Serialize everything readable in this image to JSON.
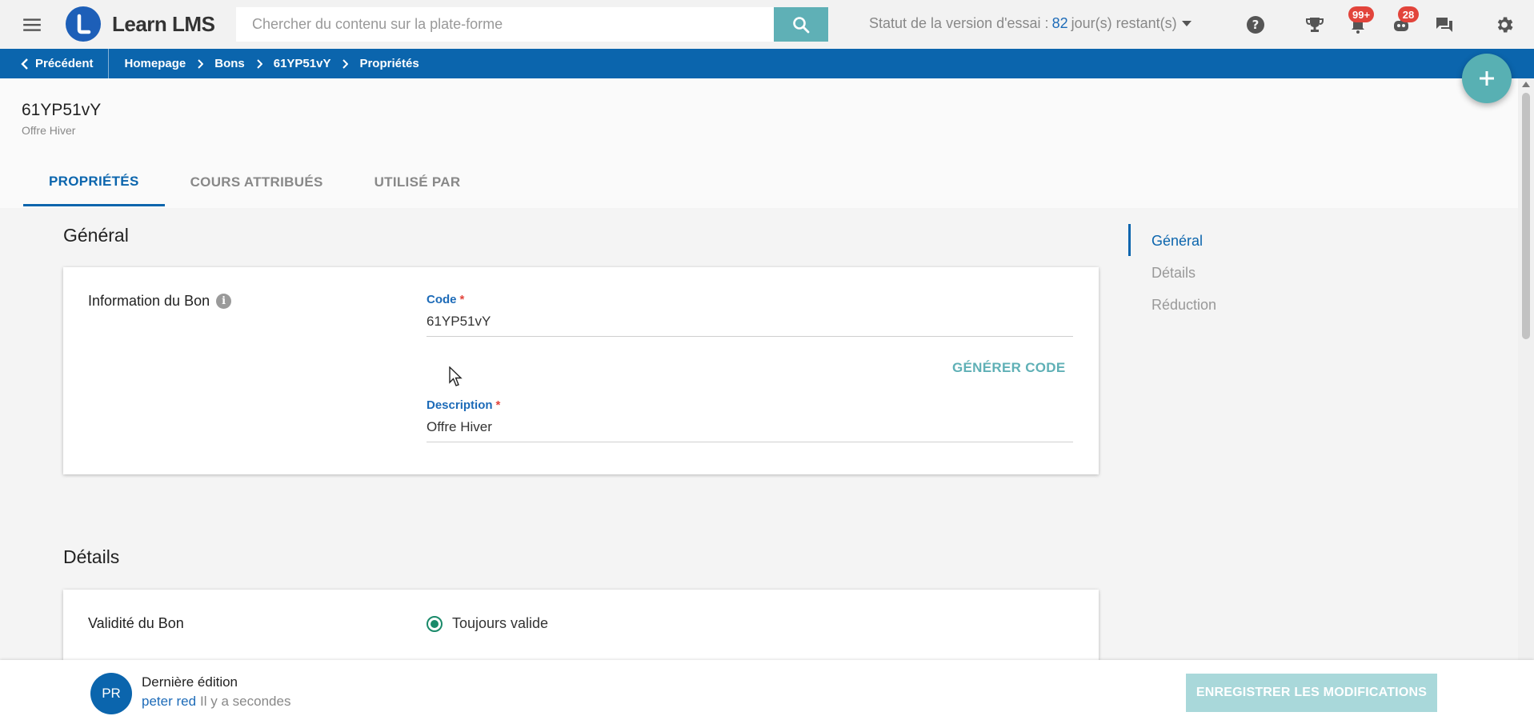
{
  "app": {
    "title": "Learn LMS",
    "search_placeholder": "Chercher du contenu sur la plate-forme",
    "trial": {
      "prefix": "Statut de la version d'essai :",
      "days": "82",
      "suffix": "jour(s) restant(s)"
    },
    "badges": {
      "notifications": "99+",
      "messages": "28"
    }
  },
  "breadcrumb": {
    "back_label": "Précédent",
    "items": [
      "Homepage",
      "Bons",
      "61YP51vY",
      "Propriétés"
    ]
  },
  "header": {
    "title": "61YP51vY",
    "subtitle": "Offre Hiver",
    "tabs": [
      {
        "label": "PROPRIÉTÉS",
        "active": true
      },
      {
        "label": "COURS ATTRIBUÉS",
        "active": false
      },
      {
        "label": "UTILISÉ PAR",
        "active": false
      }
    ]
  },
  "general": {
    "section_title": "Général",
    "card_label": "Information du Bon",
    "code_label": "Code",
    "code_value": "61YP51vY",
    "generate_label": "GÉNÉRER CODE",
    "description_label": "Description",
    "description_value": "Offre Hiver"
  },
  "details": {
    "section_title": "Détails",
    "card_label": "Validité du Bon",
    "radio_option": "Toujours valide"
  },
  "sidenav": {
    "items": [
      {
        "label": "Général",
        "active": true
      },
      {
        "label": "Détails",
        "active": false
      },
      {
        "label": "Réduction",
        "active": false
      }
    ]
  },
  "footer": {
    "avatar_initials": "PR",
    "edit_title": "Dernière édition",
    "user": "peter red",
    "time": "Il y a secondes",
    "save_label": "ENREGISTRER LES MODIFICATIONS"
  },
  "colors": {
    "primary": "#0b65ad",
    "accent": "#5fb0b6",
    "badge": "#e2443b",
    "save_disabled": "#a9d8da"
  }
}
